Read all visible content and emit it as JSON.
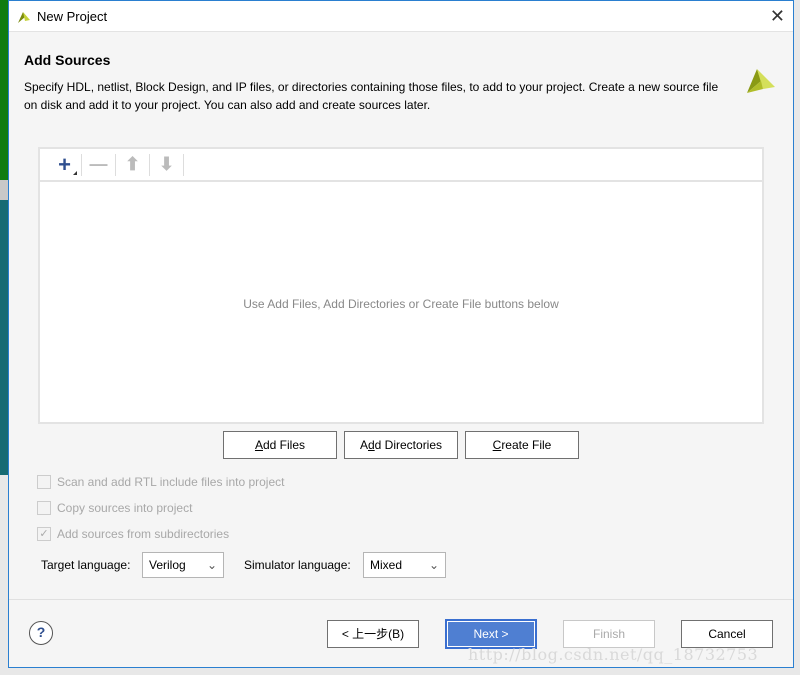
{
  "window": {
    "title": "New Project",
    "close": "✕"
  },
  "header": {
    "title": "Add Sources",
    "description": "Specify HDL, netlist, Block Design, and IP files, or directories containing those files, to add to your project. Create a new source file on disk and add it to your project. You can also add and create sources later."
  },
  "toolbar": {
    "add": "+",
    "remove": "—",
    "up": "⬆",
    "down": "⬇"
  },
  "panel": {
    "empty_text": "Use Add Files, Add Directories or Create File buttons below"
  },
  "buttons": {
    "add_files": {
      "u": "A",
      "rest": "dd Files"
    },
    "add_directories": {
      "pre": "A",
      "u": "d",
      "rest": "d Directories"
    },
    "create_file": {
      "u": "C",
      "rest": "reate File"
    }
  },
  "options": [
    {
      "label": "Scan and add RTL include files into project",
      "checked": false
    },
    {
      "label": "Copy sources into project",
      "checked": false
    },
    {
      "label": "Add sources from subdirectories",
      "checked": true
    }
  ],
  "target_language": {
    "label": "Target language:",
    "value": "Verilog"
  },
  "simulator_language": {
    "label": "Simulator language:",
    "value": "Mixed"
  },
  "footer": {
    "help": "?",
    "back": "< 上一步(B)",
    "next": "Next >",
    "finish": "Finish",
    "cancel": "Cancel"
  },
  "watermark": "http://blog.csdn.net/qq_18732753",
  "colors": {
    "accent": "#4f7fd2",
    "brand": "#9aa81c",
    "border": "#2a7fd0"
  }
}
